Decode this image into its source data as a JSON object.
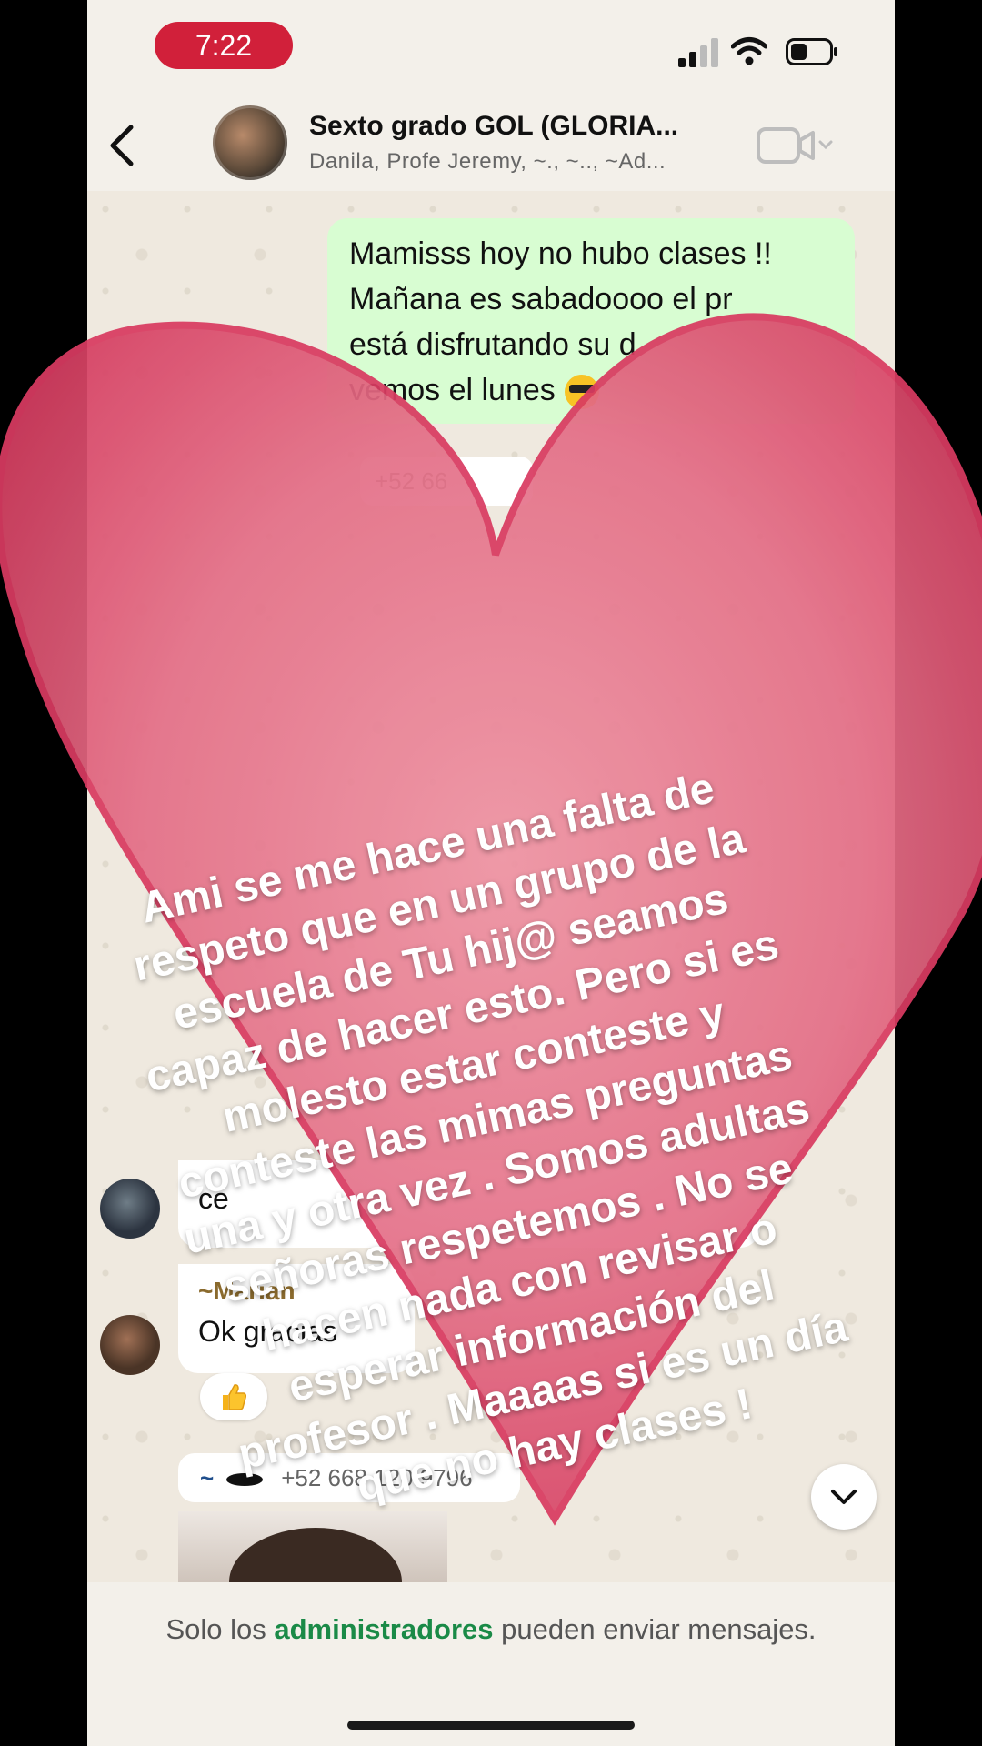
{
  "status_bar": {
    "time": "7:22"
  },
  "header": {
    "title": "Sexto grado GOL  (GLORIA...",
    "subtitle": "Danila, Profe Jeremy, ~., ~.., ~Ad..."
  },
  "messages": {
    "outgoing_lines": [
      "Mamisss hoy no hubo clases !!",
      "Mañana es sabadoooo el pr",
      "está disfrutando su d",
      "vemos el lunes"
    ],
    "sender_pill": "+52 66",
    "incoming_1_text": "ce",
    "incoming_2_sender": "~Marian",
    "incoming_2_text": "Ok gracias",
    "reaction_emoji": "thumbs-up-icon",
    "sender_pill_2_tilde": "~",
    "sender_pill_2_phone": "+52 668 120 9796"
  },
  "overlay": {
    "lines": [
      "Ami se me hace una falta de",
      "respeto que en un grupo de la",
      "escuela de Tu hij@ seamos",
      "capaz de hacer esto. Pero si es",
      "molesto estar conteste y",
      "conteste las mimas preguntas",
      "una y otra vez . Somos adultas",
      "señoras respetemos . No se",
      "hacen nada con revisar o",
      "esperar información del",
      "profesor . Maaaas si es un día",
      "que no hay clases !"
    ],
    "heart_color": "#e0506e"
  },
  "footer": {
    "prefix": "Solo los ",
    "link": "administradores",
    "suffix": " pueden enviar mensajes."
  }
}
